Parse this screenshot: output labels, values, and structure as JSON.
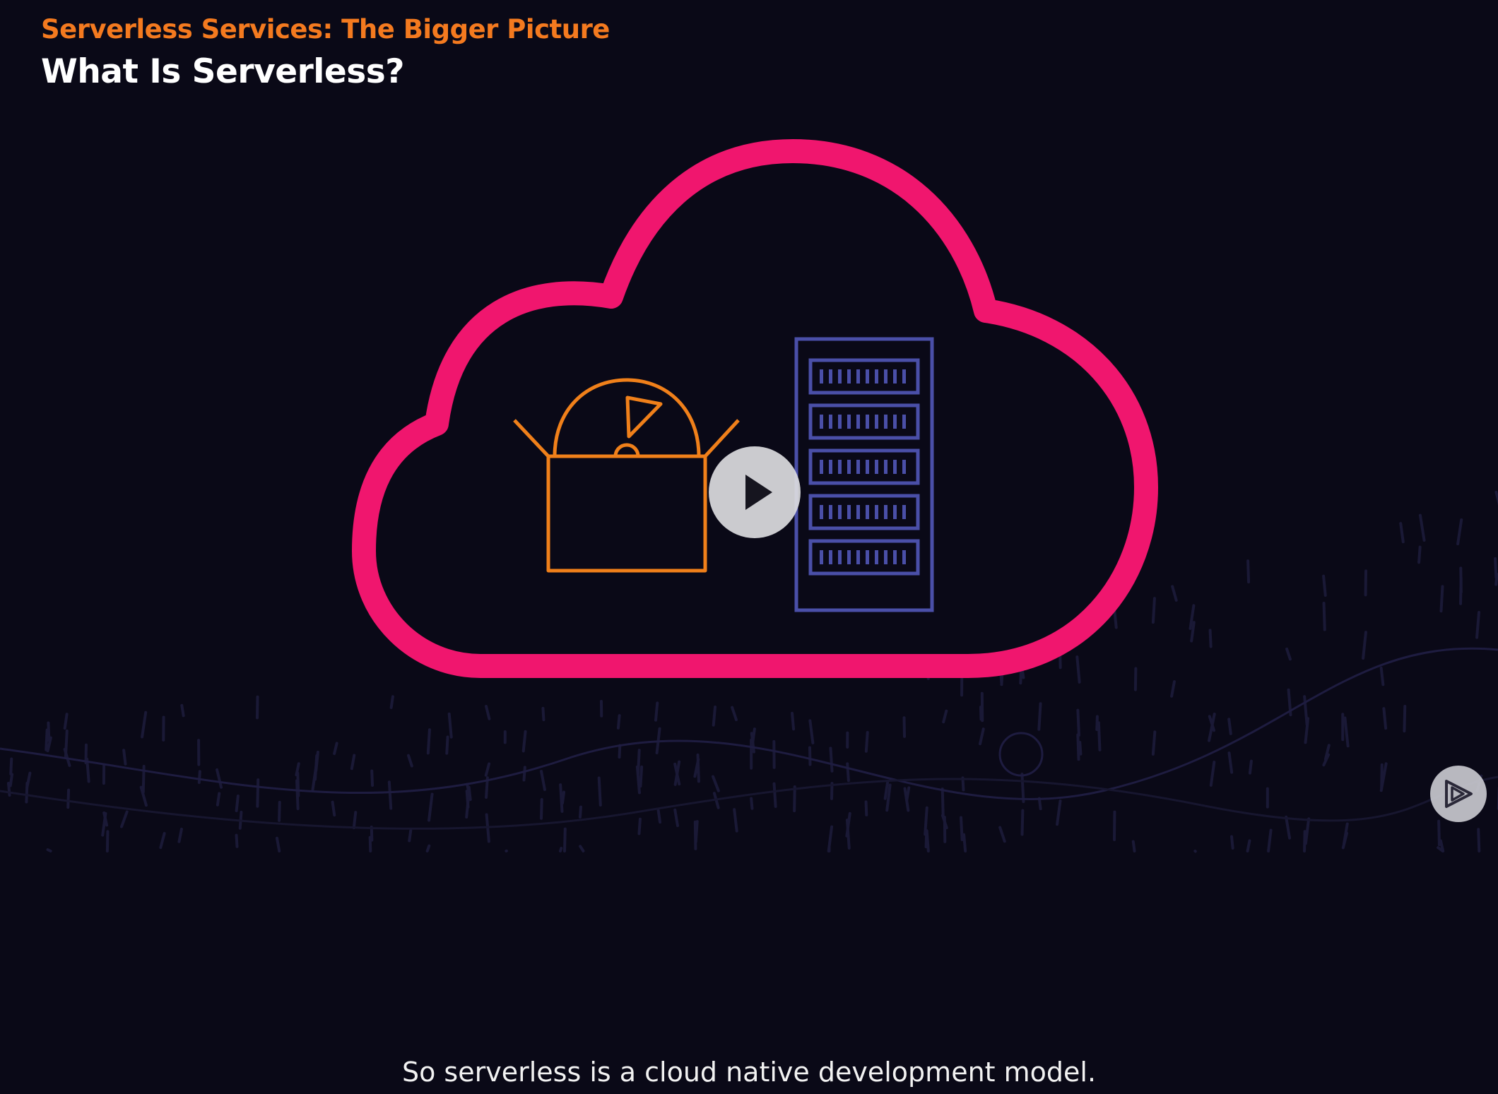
{
  "header": {
    "course_title": "Serverless Services: The Bigger Picture",
    "clip_title": "What Is Serverless?"
  },
  "player": {
    "play_icon": "play-icon",
    "next_icon": "next-clip-icon"
  },
  "caption": {
    "text": "So serverless is a cloud native development model."
  },
  "colors": {
    "background": "#0a0917",
    "course_title": "#f47a1f",
    "cloud_outline": "#f0166e",
    "package_outline": "#f0801a",
    "server_outline": "#4a4fa8"
  }
}
